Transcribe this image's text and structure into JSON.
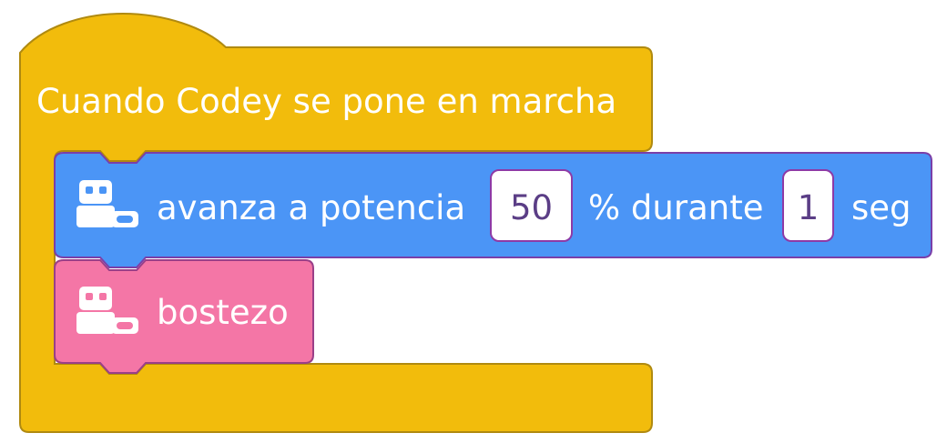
{
  "colors": {
    "event_block": "#f2bc0c",
    "event_border": "#b08a10",
    "motion_block": "#4b95f6",
    "motion_border": "#7a3fa8",
    "looks_block": "#f476a6",
    "looks_border": "#9a3f88",
    "field_bg": "#ffffff",
    "field_border": "#8e3aa6",
    "field_text": "#5b3e86"
  },
  "hat_block": {
    "label": "Cuando Codey se pone en marcha"
  },
  "move_block": {
    "icon": "codey-robot-icon",
    "label_prefix": "avanza a potencia",
    "power_value": "50",
    "label_middle": "% durante",
    "time_value": "1",
    "label_suffix": "seg"
  },
  "yawn_block": {
    "icon": "codey-robot-icon",
    "label": "bostezo"
  }
}
